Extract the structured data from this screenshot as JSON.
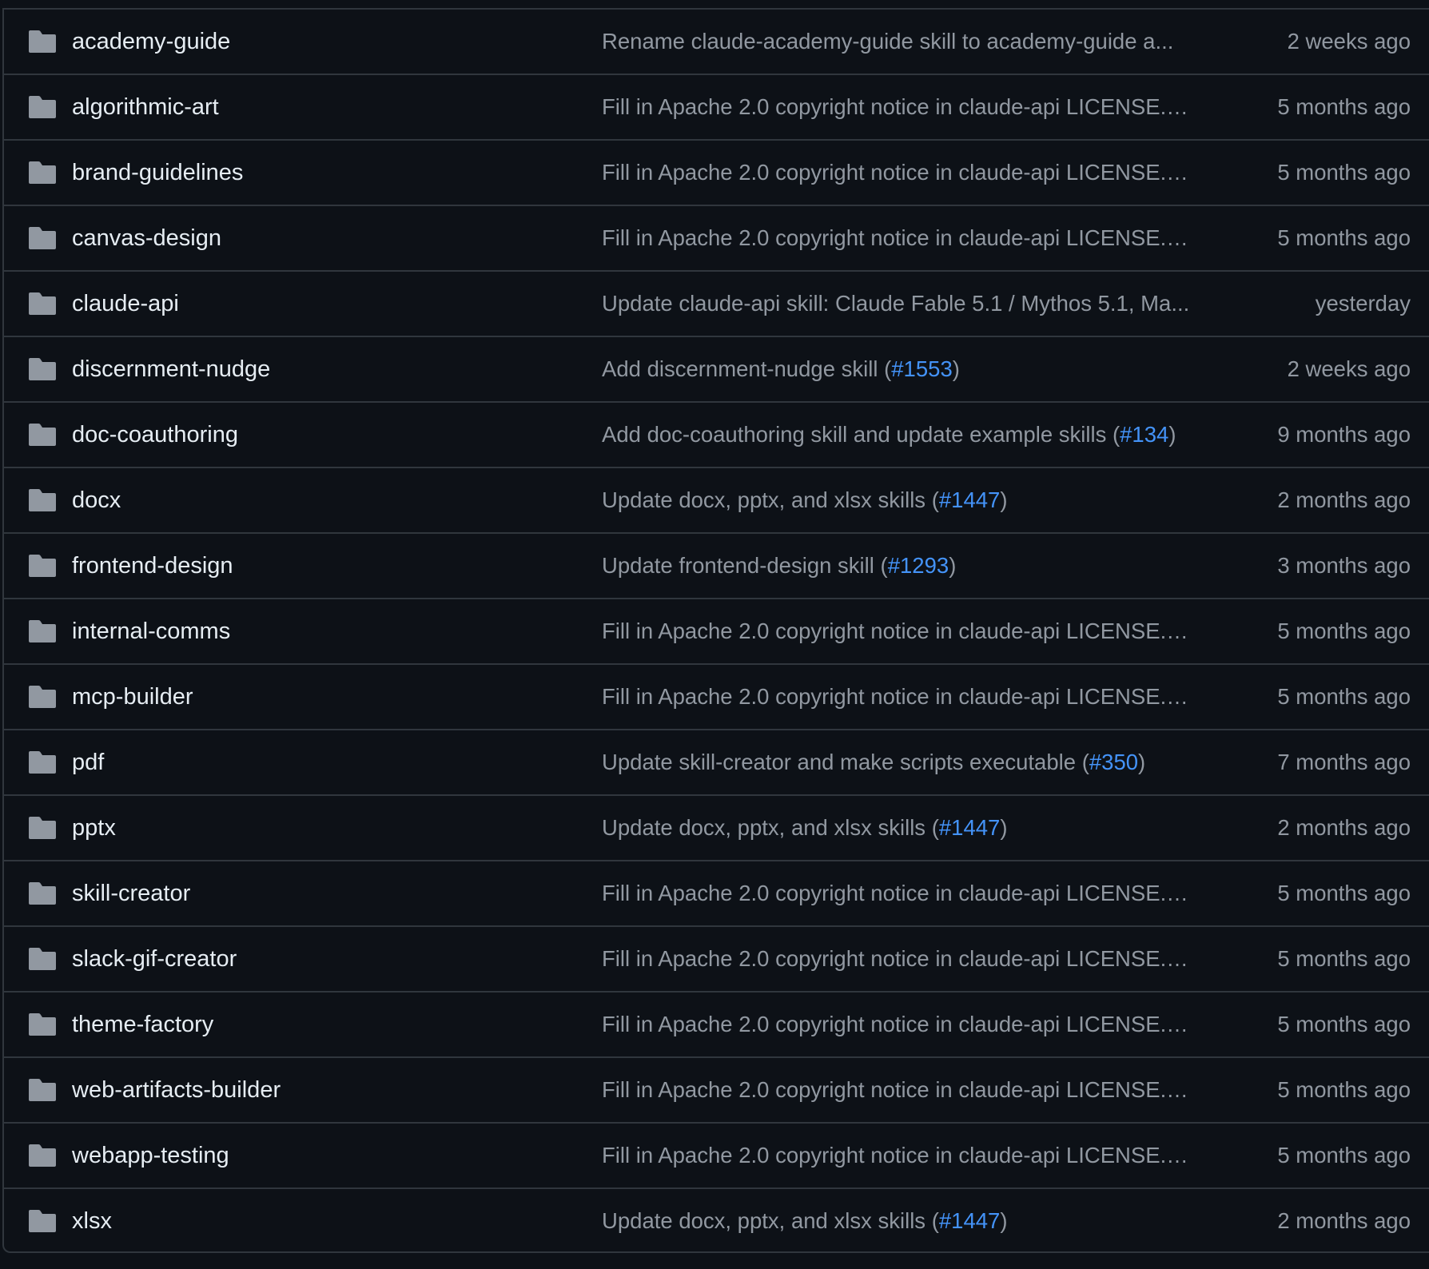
{
  "colors": {
    "background": "#0d1117",
    "border": "#30363d",
    "folder_icon": "#9198a1",
    "name_text": "#e6edf3",
    "muted_text": "#9198a1",
    "link": "#4493f8"
  },
  "rows": [
    {
      "icon": "folder-icon",
      "name": "academy-guide",
      "message": "Rename claude-academy-guide skill to academy-guide a...",
      "pr": "",
      "time": "2 weeks ago"
    },
    {
      "icon": "folder-icon",
      "name": "algorithmic-art",
      "message": "Fill in Apache 2.0 copyright notice in claude-api LICENSE.…",
      "pr": "",
      "time": "5 months ago"
    },
    {
      "icon": "folder-icon",
      "name": "brand-guidelines",
      "message": "Fill in Apache 2.0 copyright notice in claude-api LICENSE.…",
      "pr": "",
      "time": "5 months ago"
    },
    {
      "icon": "folder-icon",
      "name": "canvas-design",
      "message": "Fill in Apache 2.0 copyright notice in claude-api LICENSE.…",
      "pr": "",
      "time": "5 months ago"
    },
    {
      "icon": "folder-icon",
      "name": "claude-api",
      "message": "Update claude-api skill: Claude Fable 5.1 / Mythos 5.1, Ma...",
      "pr": "",
      "time": "yesterday"
    },
    {
      "icon": "folder-icon",
      "name": "discernment-nudge",
      "message": "Add discernment-nudge skill (",
      "pr": "#1553",
      "time": "2 weeks ago"
    },
    {
      "icon": "folder-icon",
      "name": "doc-coauthoring",
      "message": "Add doc-coauthoring skill and update example skills (",
      "pr": "#134",
      "time": "9 months ago"
    },
    {
      "icon": "folder-icon",
      "name": "docx",
      "message": "Update docx, pptx, and xlsx skills (",
      "pr": "#1447",
      "time": "2 months ago"
    },
    {
      "icon": "folder-icon",
      "name": "frontend-design",
      "message": "Update frontend-design skill (",
      "pr": "#1293",
      "time": "3 months ago"
    },
    {
      "icon": "folder-icon",
      "name": "internal-comms",
      "message": "Fill in Apache 2.0 copyright notice in claude-api LICENSE.…",
      "pr": "",
      "time": "5 months ago"
    },
    {
      "icon": "folder-icon",
      "name": "mcp-builder",
      "message": "Fill in Apache 2.0 copyright notice in claude-api LICENSE.…",
      "pr": "",
      "time": "5 months ago"
    },
    {
      "icon": "folder-icon",
      "name": "pdf",
      "message": "Update skill-creator and make scripts executable (",
      "pr": "#350",
      "time": "7 months ago"
    },
    {
      "icon": "folder-icon",
      "name": "pptx",
      "message": "Update docx, pptx, and xlsx skills (",
      "pr": "#1447",
      "time": "2 months ago"
    },
    {
      "icon": "folder-icon",
      "name": "skill-creator",
      "message": "Fill in Apache 2.0 copyright notice in claude-api LICENSE.…",
      "pr": "",
      "time": "5 months ago"
    },
    {
      "icon": "folder-icon",
      "name": "slack-gif-creator",
      "message": "Fill in Apache 2.0 copyright notice in claude-api LICENSE.…",
      "pr": "",
      "time": "5 months ago"
    },
    {
      "icon": "folder-icon",
      "name": "theme-factory",
      "message": "Fill in Apache 2.0 copyright notice in claude-api LICENSE.…",
      "pr": "",
      "time": "5 months ago"
    },
    {
      "icon": "folder-icon",
      "name": "web-artifacts-builder",
      "message": "Fill in Apache 2.0 copyright notice in claude-api LICENSE.…",
      "pr": "",
      "time": "5 months ago"
    },
    {
      "icon": "folder-icon",
      "name": "webapp-testing",
      "message": "Fill in Apache 2.0 copyright notice in claude-api LICENSE.…",
      "pr": "",
      "time": "5 months ago"
    },
    {
      "icon": "folder-icon",
      "name": "xlsx",
      "message": "Update docx, pptx, and xlsx skills (",
      "pr": "#1447",
      "time": "2 months ago"
    }
  ]
}
